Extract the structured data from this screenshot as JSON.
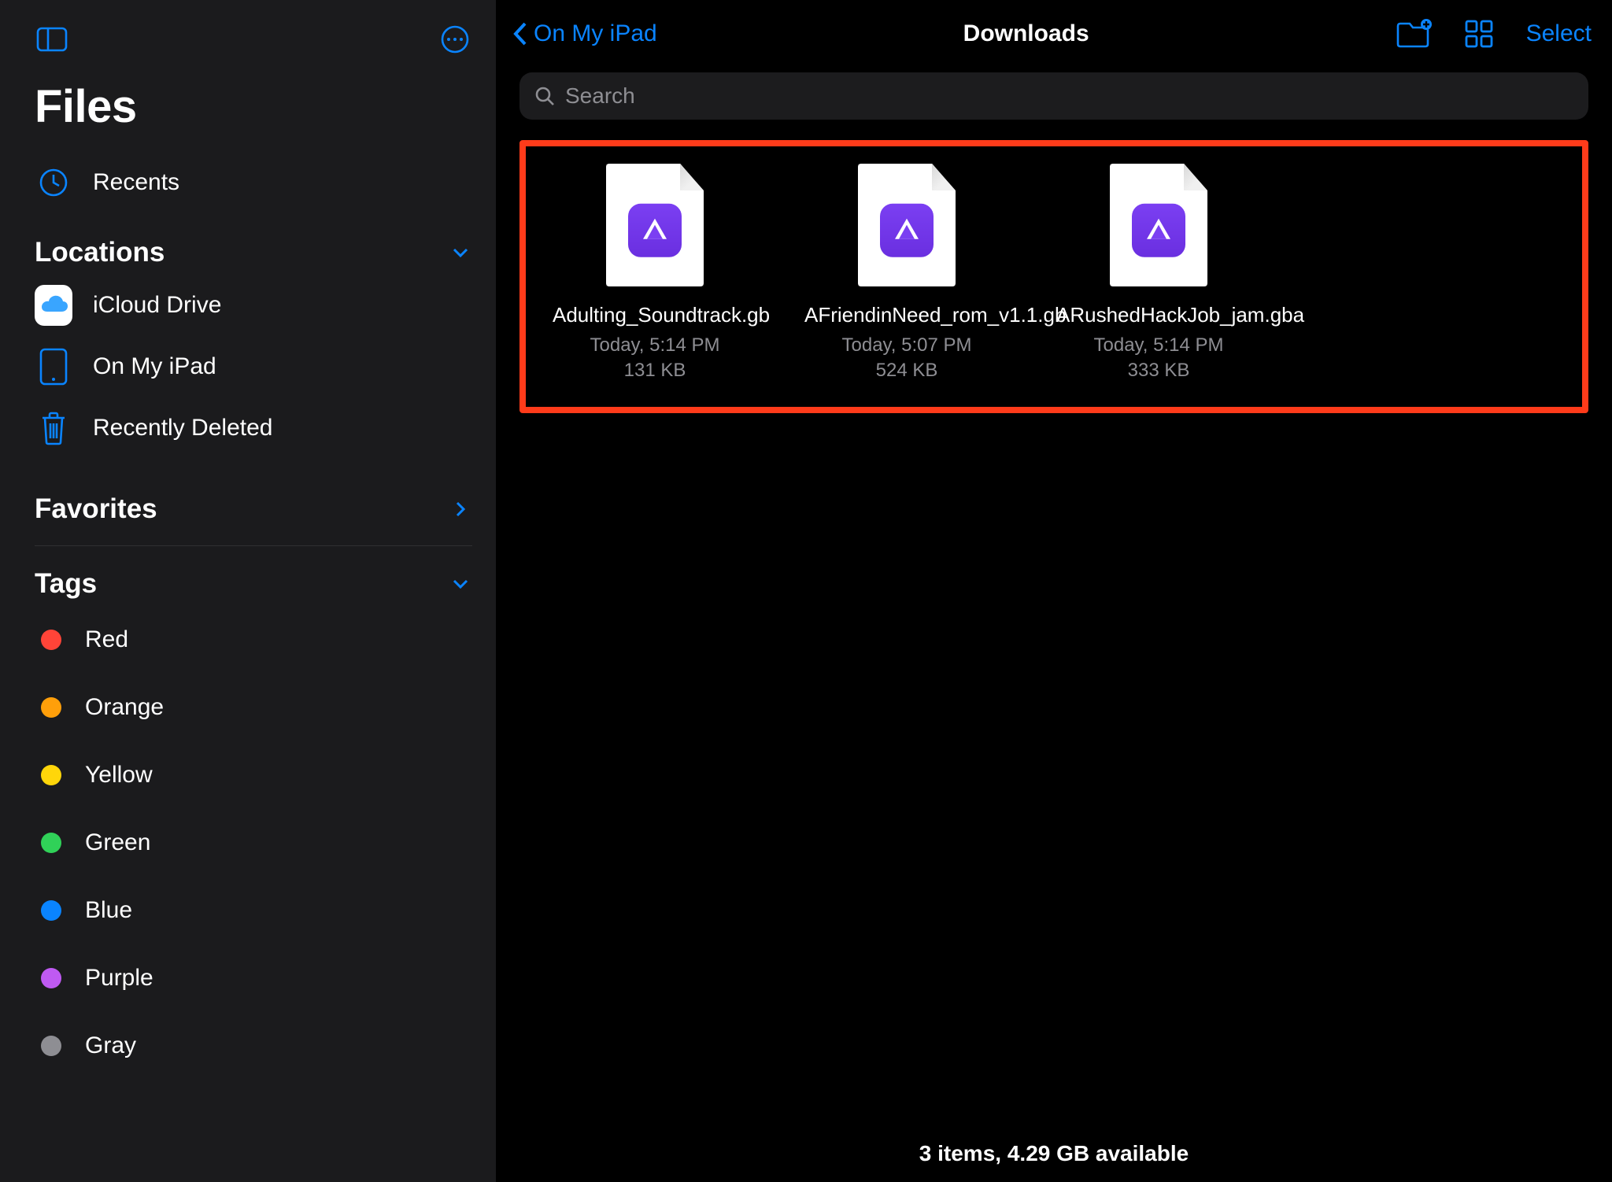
{
  "sidebar": {
    "title": "Files",
    "recents_label": "Recents",
    "sections": {
      "locations": {
        "label": "Locations",
        "items": [
          {
            "label": "iCloud Drive"
          },
          {
            "label": "On My iPad"
          },
          {
            "label": "Recently Deleted"
          }
        ]
      },
      "favorites": {
        "label": "Favorites"
      },
      "tags": {
        "label": "Tags",
        "items": [
          {
            "label": "Red",
            "color": "#ff4438"
          },
          {
            "label": "Orange",
            "color": "#ff9f0a"
          },
          {
            "label": "Yellow",
            "color": "#ffd60a"
          },
          {
            "label": "Green",
            "color": "#30d158"
          },
          {
            "label": "Blue",
            "color": "#0a84ff"
          },
          {
            "label": "Purple",
            "color": "#bf5af2"
          },
          {
            "label": "Gray",
            "color": "#8e8e93"
          }
        ]
      }
    }
  },
  "toolbar": {
    "back_label": "On My iPad",
    "title": "Downloads",
    "select_label": "Select"
  },
  "search": {
    "placeholder": "Search",
    "value": ""
  },
  "files": [
    {
      "name": "Adulting_Soundtrack.gb",
      "date": "Today, 5:14 PM",
      "size": "131 KB"
    },
    {
      "name": "AFriendinNeed_rom_v1.1.gb",
      "date": "Today, 5:07 PM",
      "size": "524 KB"
    },
    {
      "name": "ARushedHackJob_jam.gba",
      "date": "Today, 5:14 PM",
      "size": "333 KB"
    }
  ],
  "footer": {
    "status": "3 items, 4.29 GB available"
  },
  "colors": {
    "accent": "#0a84ff",
    "highlight_border": "#ff3b1a"
  }
}
